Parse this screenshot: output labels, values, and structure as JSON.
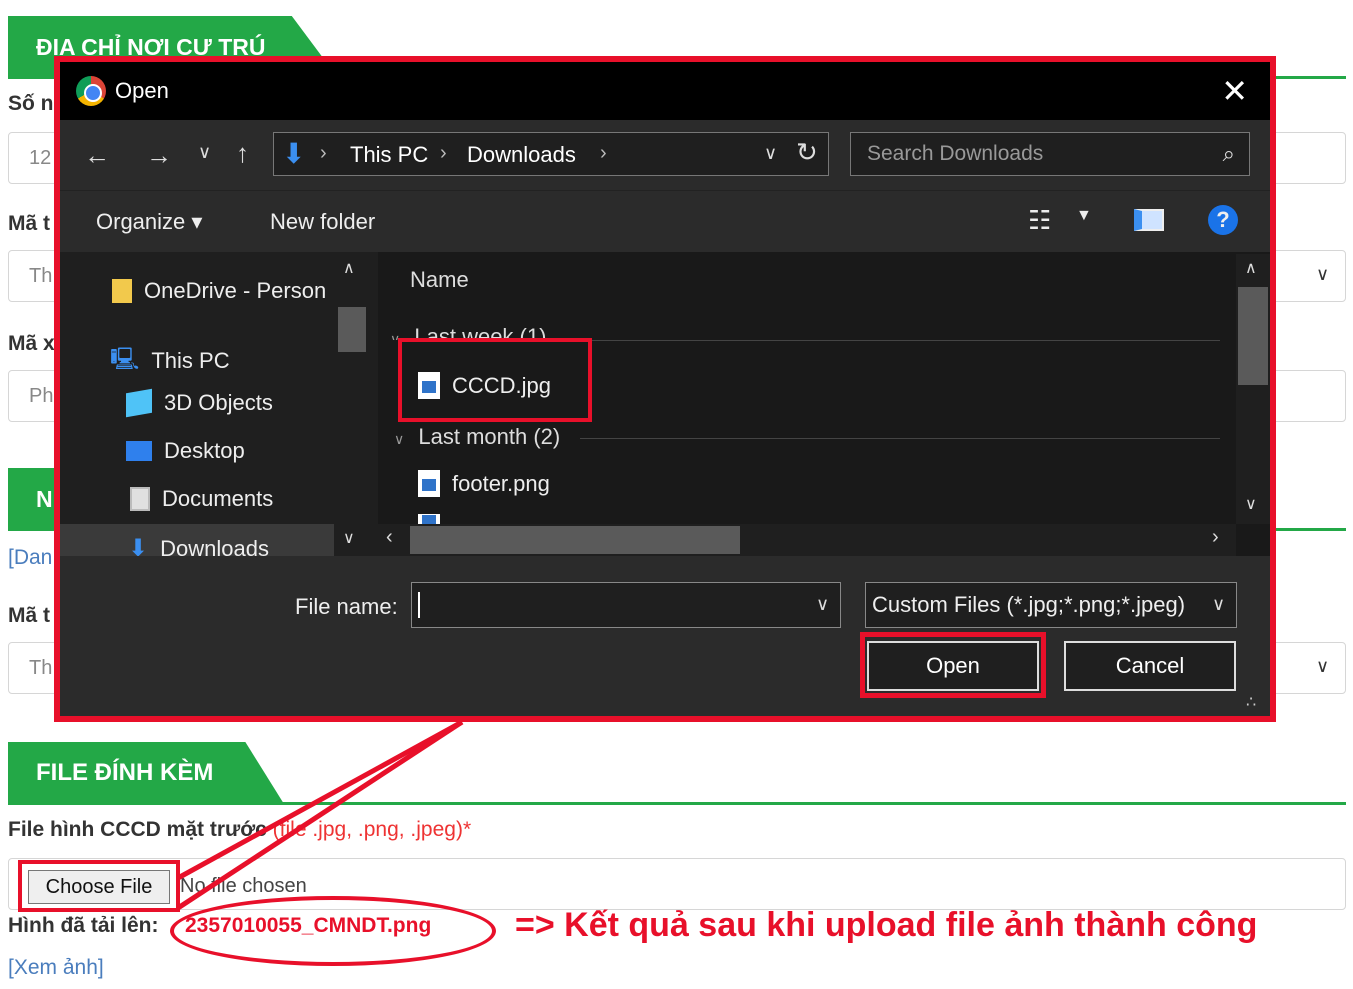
{
  "form": {
    "section_address": "ĐỊA CHỈ NƠI CƯ TRÚ",
    "label_so": "Số n",
    "value_so": "12",
    "label_ma_tinh": "Mã t",
    "value_ma_tinh": "Th",
    "label_ma_xa": "Mã x",
    "value_ma_xa": "Ph",
    "section_n": "N",
    "link_dan": "[Dan",
    "label_ma_t2": "Mã t",
    "value_ma_t2": "Th",
    "section_files": "FILE ĐÍNH KÈM",
    "file_label": "File hình CCCD mặt trước",
    "file_hint": "(file .jpg, .png, .jpeg)*",
    "choose_file": "Choose File",
    "no_file": "No file chosen",
    "uploaded_label": "Hình đã tải lên:",
    "uploaded_file": "2357010055_CMNDT.png",
    "result_note": "=> Kết quả sau khi upload file ảnh thành công",
    "view_link": "[Xem ảnh]"
  },
  "dialog": {
    "title": "Open",
    "close_icon": "close-icon",
    "path": [
      "This PC",
      "Downloads"
    ],
    "search_placeholder": "Search Downloads",
    "toolbar": {
      "organize": "Organize ▾",
      "new_folder": "New folder"
    },
    "nav": [
      "OneDrive - Person",
      "This PC",
      "3D Objects",
      "Desktop",
      "Documents",
      "Downloads"
    ],
    "column_name": "Name",
    "groups": [
      {
        "label": "Last week (1)",
        "files": [
          "CCCD.jpg"
        ]
      },
      {
        "label": "Last month (2)",
        "files": [
          "footer.png"
        ]
      }
    ],
    "file_name_label": "File name:",
    "file_name_value": "",
    "file_type": "Custom Files (*.jpg;*.png;*.jpeg)",
    "open_button": "Open",
    "cancel_button": "Cancel"
  },
  "colors": {
    "accent_green": "#23a847",
    "annotation_red": "#e8102a",
    "link_blue": "#4a7dbd"
  }
}
